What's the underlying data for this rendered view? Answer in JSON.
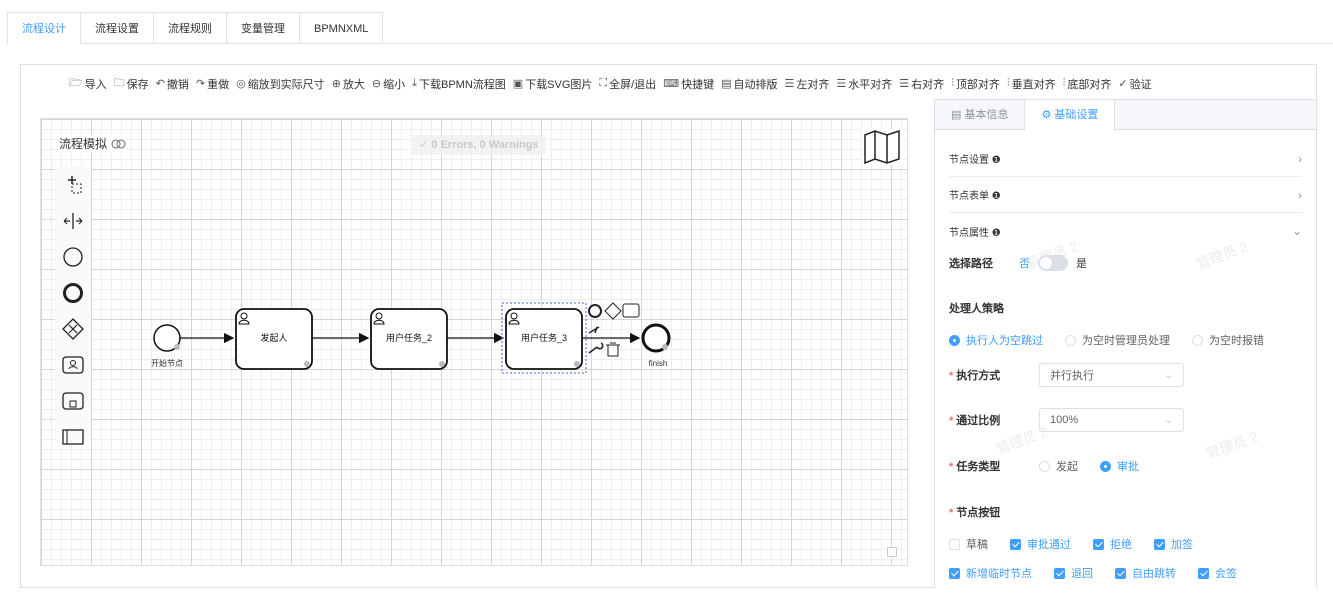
{
  "top_tabs": [
    "流程设计",
    "流程设置",
    "流程规则",
    "变量管理",
    "BPMNXML"
  ],
  "toolbar": {
    "import": "导入",
    "save": "保存",
    "undo": "撤销",
    "redo": "重做",
    "fit": "缩放到实际尺寸",
    "zoom_in": "放大",
    "zoom_out": "缩小",
    "download_bpmn": "下载BPMN流程图",
    "download_svg": "下载SVG图片",
    "fullscreen": "全屏/退出",
    "shortcuts": "快捷键",
    "auto_layout": "自动排版",
    "align_left": "左对齐",
    "align_hcenter": "水平对齐",
    "align_right": "右对齐",
    "align_top": "顶部对齐",
    "align_vcenter": "垂直对齐",
    "align_bottom": "底部对齐",
    "validate": "验证"
  },
  "canvas": {
    "simulation_label": "流程模拟",
    "errors_label": "0 Errors, 0 Warnings",
    "nodes": {
      "start": "开始节点",
      "task1": "发起人",
      "task2": "用户任务_2",
      "task3": "用户任务_3",
      "end": "finish"
    }
  },
  "panel": {
    "tabs": [
      "基本信息",
      "基础设置"
    ],
    "sections": {
      "node_settings": "节点设置",
      "node_form": "节点表单",
      "node_props": "节点属性"
    },
    "select_path": {
      "label": "选择路径",
      "off": "否",
      "on": "是"
    },
    "handler_strategy": {
      "label": "处理人策略",
      "options": [
        "执行人为空跳过",
        "为空时管理员处理",
        "为空时报错"
      ]
    },
    "exec_mode": {
      "label": "执行方式",
      "value": "并行执行"
    },
    "pass_ratio": {
      "label": "通过比例",
      "value": "100%"
    },
    "task_type": {
      "label": "任务类型",
      "options": [
        "发起",
        "审批"
      ]
    },
    "node_buttons": {
      "label": "节点按钮",
      "row1": [
        "草稿",
        "审批通过",
        "拒绝",
        "加签"
      ],
      "row2": [
        "新增临时节点",
        "退回",
        "自由跳转",
        "会签"
      ]
    },
    "watermark": "管理员 2"
  },
  "colors": {
    "accent": "#409eff",
    "required": "#f56c6c"
  }
}
